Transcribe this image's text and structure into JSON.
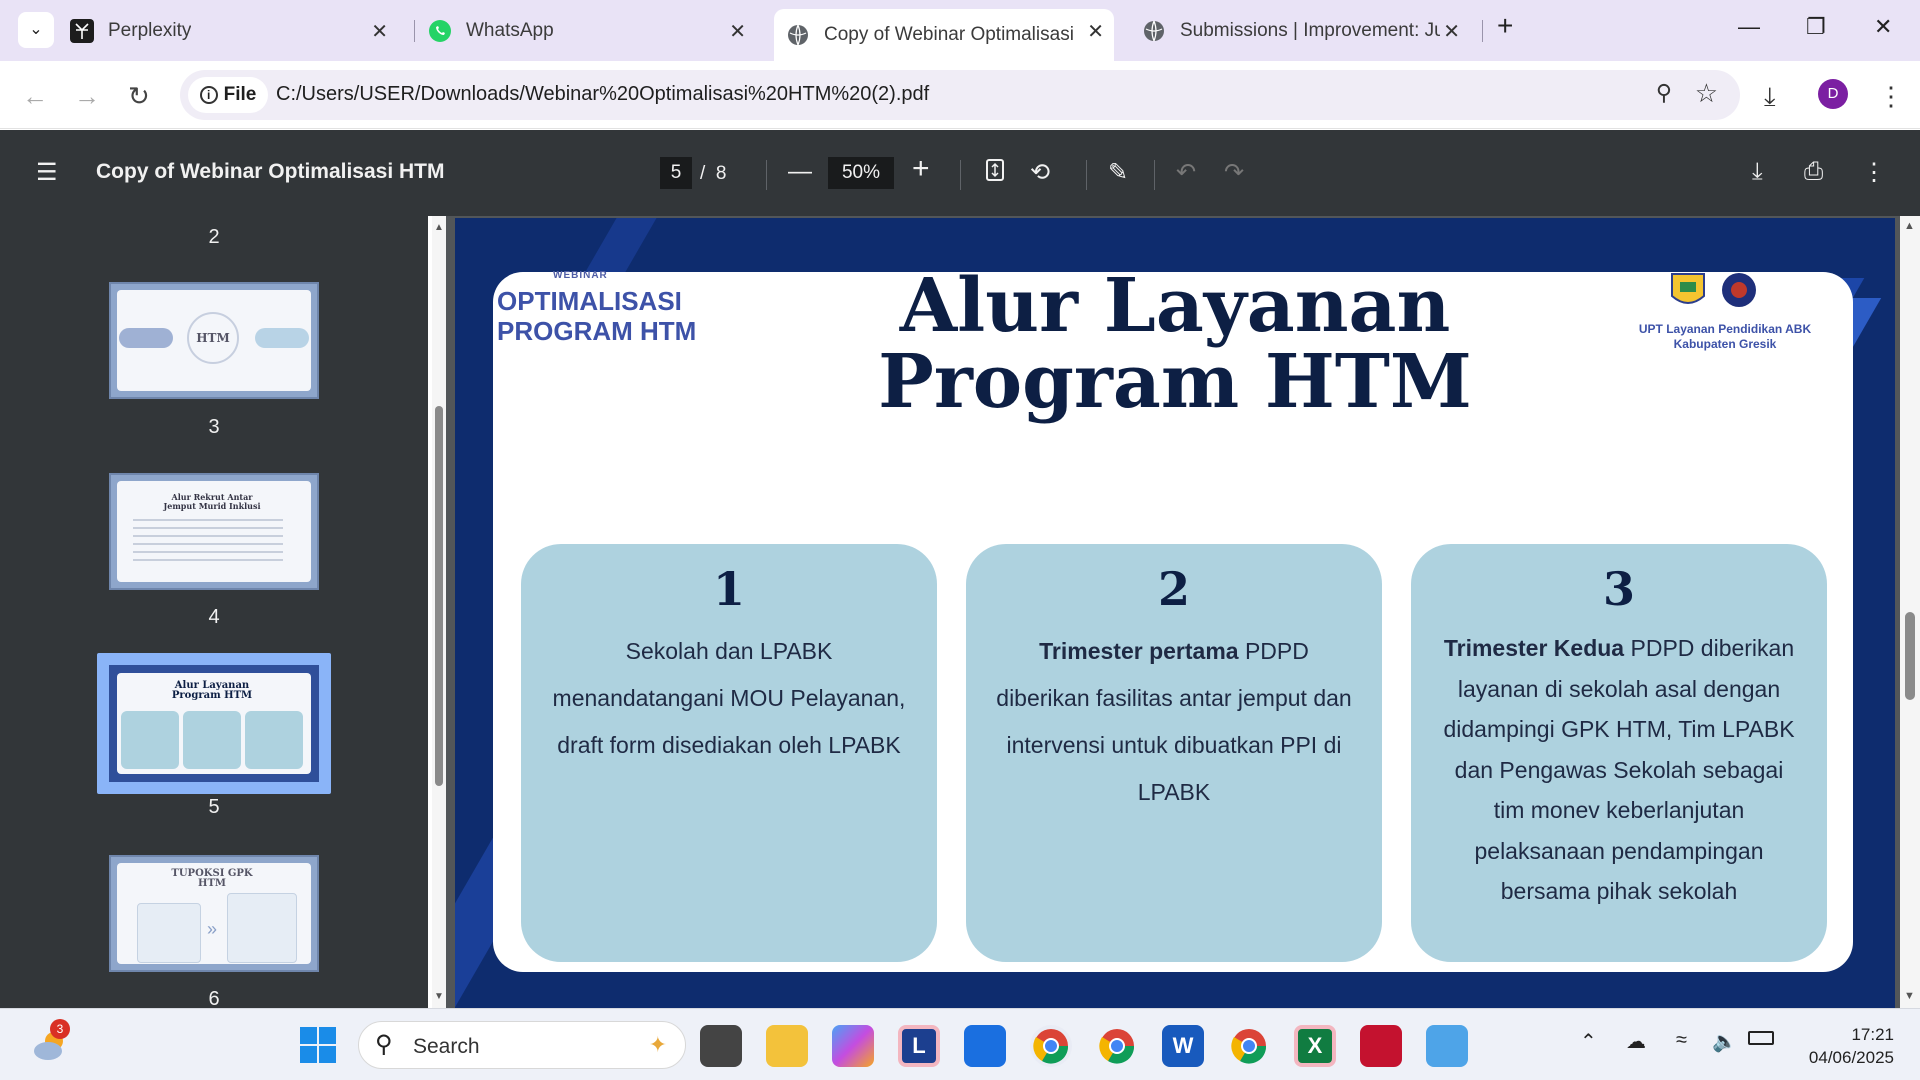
{
  "browser": {
    "tabs": [
      {
        "title": "Perplexity",
        "icon": "perplexity-icon"
      },
      {
        "title": "WhatsApp",
        "icon": "whatsapp-icon"
      },
      {
        "title": "Copy of Webinar Optimalisasi H",
        "icon": "globe-icon",
        "active": true
      },
      {
        "title": "Submissions | Improvement: Jur",
        "icon": "globe-icon"
      }
    ],
    "url_chip": "File",
    "url": "C:/Users/USER/Downloads/Webinar%20Optimalisasi%20HTM%20(2).pdf",
    "profile_initial": "D"
  },
  "pdf_toolbar": {
    "title": "Copy of Webinar Optimalisasi HTM",
    "current_page": "5",
    "separator": "/",
    "total_pages": "8",
    "zoom": "50%"
  },
  "thumbnails": {
    "page_numbers": [
      "2",
      "3",
      "4",
      "5",
      "6"
    ],
    "thumb_titles": [
      "HTM",
      "Alur Rekrut Antar Jemput Murid Inklusi",
      "Alur Layanan Program HTM",
      "TUPOKSI GPK HTM"
    ],
    "selected_page": "5"
  },
  "slide": {
    "webinar_label": "WEBINAR",
    "brand_line1": "OPTIMALISASI",
    "brand_line2": "PROGRAM HTM",
    "org_line1": "UPT Layanan Pendidikan ABK",
    "org_line2": "Kabupaten Gresik",
    "title_line1": "Alur Layanan",
    "title_line2": "Program HTM",
    "steps": [
      {
        "number": "1",
        "bold": "",
        "text": "Sekolah dan LPABK menandatangani MOU Pelayanan, draft form disediakan oleh LPABK"
      },
      {
        "number": "2",
        "bold": "Trimester pertama",
        "text": " PDPD diberikan fasilitas antar jemput dan intervensi untuk dibuatkan PPI di LPABK"
      },
      {
        "number": "3",
        "bold": "Trimester Kedua",
        "text": " PDPD diberikan layanan di sekolah asal dengan didampingi GPK HTM, Tim LPABK dan Pengawas Sekolah sebagai tim monev keberlanjutan pelaksanaan pendampingan bersama pihak sekolah"
      }
    ]
  },
  "taskbar": {
    "search_placeholder": "Search",
    "weather_badge": "3",
    "time": "17:21",
    "date": "04/06/2025"
  }
}
